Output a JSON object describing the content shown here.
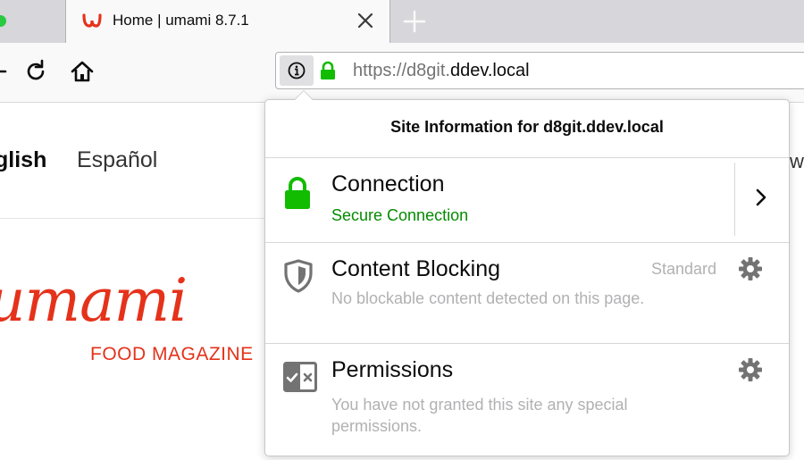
{
  "tab": {
    "title": "Home | umami 8.7.1",
    "new_tab_glyph": "+",
    "close_glyph": "✕"
  },
  "urlbar": {
    "url_prefix": "https://d8git.",
    "url_domain": "ddev.local"
  },
  "page": {
    "lang_english": "glish",
    "lang_espanol": "Español",
    "logo_text": "umami",
    "logo_tagline": "FOOD MAGAZINE",
    "right_fragment": "wo"
  },
  "popup": {
    "title": "Site Information for d8git.ddev.local",
    "connection": {
      "heading": "Connection",
      "status": "Secure Connection"
    },
    "content_blocking": {
      "heading": "Content Blocking",
      "mode": "Standard",
      "status": "No blockable content detected on this page."
    },
    "permissions": {
      "heading": "Permissions",
      "status_line1": "You have not granted this site any special",
      "status_line2": "permissions."
    }
  },
  "icons": {
    "favicon": "umami-favicon",
    "close": "close-icon",
    "new_tab": "plus-icon",
    "back": "back-arrow-icon",
    "reload": "reload-icon",
    "home": "home-icon",
    "info": "info-icon",
    "lock": "lock-icon",
    "shield": "shield-icon",
    "permissions": "permissions-icon",
    "gear": "gear-icon",
    "chevron": "chevron-right-icon"
  },
  "colors": {
    "secure_green": "#12bc00",
    "brand_red": "#e5321b"
  }
}
